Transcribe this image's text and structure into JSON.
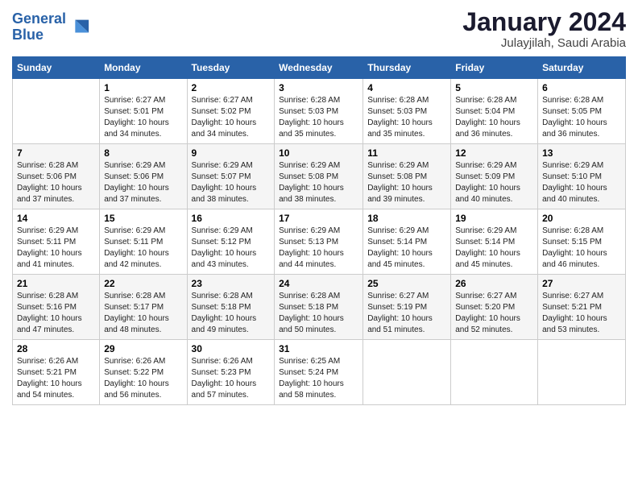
{
  "header": {
    "logo_line1": "General",
    "logo_line2": "Blue",
    "title": "January 2024",
    "subtitle": "Julayjilah, Saudi Arabia"
  },
  "columns": [
    "Sunday",
    "Monday",
    "Tuesday",
    "Wednesday",
    "Thursday",
    "Friday",
    "Saturday"
  ],
  "weeks": [
    [
      {
        "day": "",
        "sunrise": "",
        "sunset": "",
        "daylight": ""
      },
      {
        "day": "1",
        "sunrise": "Sunrise: 6:27 AM",
        "sunset": "Sunset: 5:01 PM",
        "daylight": "Daylight: 10 hours and 34 minutes."
      },
      {
        "day": "2",
        "sunrise": "Sunrise: 6:27 AM",
        "sunset": "Sunset: 5:02 PM",
        "daylight": "Daylight: 10 hours and 34 minutes."
      },
      {
        "day": "3",
        "sunrise": "Sunrise: 6:28 AM",
        "sunset": "Sunset: 5:03 PM",
        "daylight": "Daylight: 10 hours and 35 minutes."
      },
      {
        "day": "4",
        "sunrise": "Sunrise: 6:28 AM",
        "sunset": "Sunset: 5:03 PM",
        "daylight": "Daylight: 10 hours and 35 minutes."
      },
      {
        "day": "5",
        "sunrise": "Sunrise: 6:28 AM",
        "sunset": "Sunset: 5:04 PM",
        "daylight": "Daylight: 10 hours and 36 minutes."
      },
      {
        "day": "6",
        "sunrise": "Sunrise: 6:28 AM",
        "sunset": "Sunset: 5:05 PM",
        "daylight": "Daylight: 10 hours and 36 minutes."
      }
    ],
    [
      {
        "day": "7",
        "sunrise": "Sunrise: 6:28 AM",
        "sunset": "Sunset: 5:06 PM",
        "daylight": "Daylight: 10 hours and 37 minutes."
      },
      {
        "day": "8",
        "sunrise": "Sunrise: 6:29 AM",
        "sunset": "Sunset: 5:06 PM",
        "daylight": "Daylight: 10 hours and 37 minutes."
      },
      {
        "day": "9",
        "sunrise": "Sunrise: 6:29 AM",
        "sunset": "Sunset: 5:07 PM",
        "daylight": "Daylight: 10 hours and 38 minutes."
      },
      {
        "day": "10",
        "sunrise": "Sunrise: 6:29 AM",
        "sunset": "Sunset: 5:08 PM",
        "daylight": "Daylight: 10 hours and 38 minutes."
      },
      {
        "day": "11",
        "sunrise": "Sunrise: 6:29 AM",
        "sunset": "Sunset: 5:08 PM",
        "daylight": "Daylight: 10 hours and 39 minutes."
      },
      {
        "day": "12",
        "sunrise": "Sunrise: 6:29 AM",
        "sunset": "Sunset: 5:09 PM",
        "daylight": "Daylight: 10 hours and 40 minutes."
      },
      {
        "day": "13",
        "sunrise": "Sunrise: 6:29 AM",
        "sunset": "Sunset: 5:10 PM",
        "daylight": "Daylight: 10 hours and 40 minutes."
      }
    ],
    [
      {
        "day": "14",
        "sunrise": "Sunrise: 6:29 AM",
        "sunset": "Sunset: 5:11 PM",
        "daylight": "Daylight: 10 hours and 41 minutes."
      },
      {
        "day": "15",
        "sunrise": "Sunrise: 6:29 AM",
        "sunset": "Sunset: 5:11 PM",
        "daylight": "Daylight: 10 hours and 42 minutes."
      },
      {
        "day": "16",
        "sunrise": "Sunrise: 6:29 AM",
        "sunset": "Sunset: 5:12 PM",
        "daylight": "Daylight: 10 hours and 43 minutes."
      },
      {
        "day": "17",
        "sunrise": "Sunrise: 6:29 AM",
        "sunset": "Sunset: 5:13 PM",
        "daylight": "Daylight: 10 hours and 44 minutes."
      },
      {
        "day": "18",
        "sunrise": "Sunrise: 6:29 AM",
        "sunset": "Sunset: 5:14 PM",
        "daylight": "Daylight: 10 hours and 45 minutes."
      },
      {
        "day": "19",
        "sunrise": "Sunrise: 6:29 AM",
        "sunset": "Sunset: 5:14 PM",
        "daylight": "Daylight: 10 hours and 45 minutes."
      },
      {
        "day": "20",
        "sunrise": "Sunrise: 6:28 AM",
        "sunset": "Sunset: 5:15 PM",
        "daylight": "Daylight: 10 hours and 46 minutes."
      }
    ],
    [
      {
        "day": "21",
        "sunrise": "Sunrise: 6:28 AM",
        "sunset": "Sunset: 5:16 PM",
        "daylight": "Daylight: 10 hours and 47 minutes."
      },
      {
        "day": "22",
        "sunrise": "Sunrise: 6:28 AM",
        "sunset": "Sunset: 5:17 PM",
        "daylight": "Daylight: 10 hours and 48 minutes."
      },
      {
        "day": "23",
        "sunrise": "Sunrise: 6:28 AM",
        "sunset": "Sunset: 5:18 PM",
        "daylight": "Daylight: 10 hours and 49 minutes."
      },
      {
        "day": "24",
        "sunrise": "Sunrise: 6:28 AM",
        "sunset": "Sunset: 5:18 PM",
        "daylight": "Daylight: 10 hours and 50 minutes."
      },
      {
        "day": "25",
        "sunrise": "Sunrise: 6:27 AM",
        "sunset": "Sunset: 5:19 PM",
        "daylight": "Daylight: 10 hours and 51 minutes."
      },
      {
        "day": "26",
        "sunrise": "Sunrise: 6:27 AM",
        "sunset": "Sunset: 5:20 PM",
        "daylight": "Daylight: 10 hours and 52 minutes."
      },
      {
        "day": "27",
        "sunrise": "Sunrise: 6:27 AM",
        "sunset": "Sunset: 5:21 PM",
        "daylight": "Daylight: 10 hours and 53 minutes."
      }
    ],
    [
      {
        "day": "28",
        "sunrise": "Sunrise: 6:26 AM",
        "sunset": "Sunset: 5:21 PM",
        "daylight": "Daylight: 10 hours and 54 minutes."
      },
      {
        "day": "29",
        "sunrise": "Sunrise: 6:26 AM",
        "sunset": "Sunset: 5:22 PM",
        "daylight": "Daylight: 10 hours and 56 minutes."
      },
      {
        "day": "30",
        "sunrise": "Sunrise: 6:26 AM",
        "sunset": "Sunset: 5:23 PM",
        "daylight": "Daylight: 10 hours and 57 minutes."
      },
      {
        "day": "31",
        "sunrise": "Sunrise: 6:25 AM",
        "sunset": "Sunset: 5:24 PM",
        "daylight": "Daylight: 10 hours and 58 minutes."
      },
      {
        "day": "",
        "sunrise": "",
        "sunset": "",
        "daylight": ""
      },
      {
        "day": "",
        "sunrise": "",
        "sunset": "",
        "daylight": ""
      },
      {
        "day": "",
        "sunrise": "",
        "sunset": "",
        "daylight": ""
      }
    ]
  ]
}
